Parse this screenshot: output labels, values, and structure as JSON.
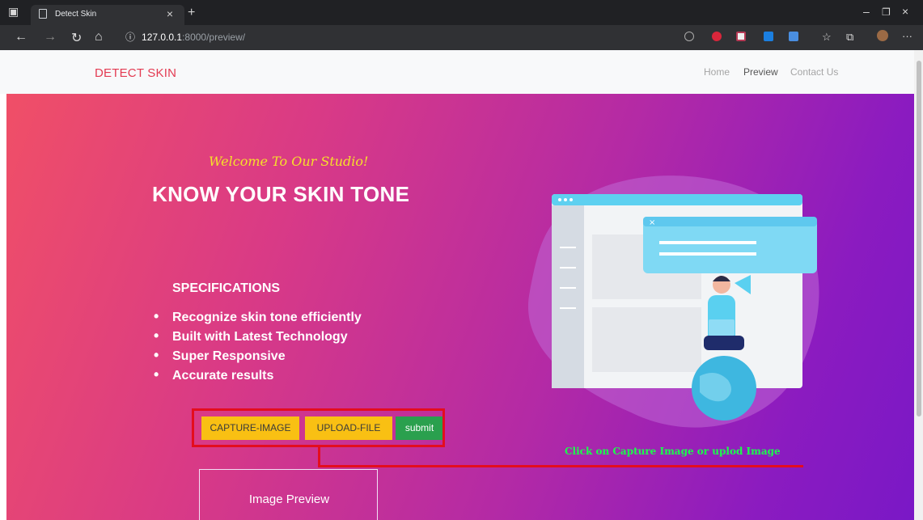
{
  "browser": {
    "tab_title": "Detect Skin",
    "url_host": "127.0.0.1",
    "url_path": ":8000/preview/"
  },
  "navbar": {
    "brand": "DETECT SKIN",
    "links": [
      "Home",
      "Preview",
      "Contact Us"
    ]
  },
  "hero": {
    "welcome": "Welcome To Our Studio!",
    "title": "KNOW YOUR SKIN TONE",
    "spec_title": "SPECIFICATIONS",
    "specs": [
      "Recognize skin tone efficiently",
      "Built with Latest Technology",
      "Super Responsive",
      "Accurate results"
    ]
  },
  "actions": {
    "capture": "CAPTURE-IMAGE",
    "upload": "UPLOAD-FILE",
    "submit": "submit"
  },
  "annotation": "Click on Capture Image or uplod Image",
  "preview": {
    "label": "Image Preview"
  },
  "colors": {
    "brand": "#e33b52",
    "accent_yellow": "#f9c013",
    "submit_green": "#2aa04e",
    "highlight": "#e40d1e"
  }
}
